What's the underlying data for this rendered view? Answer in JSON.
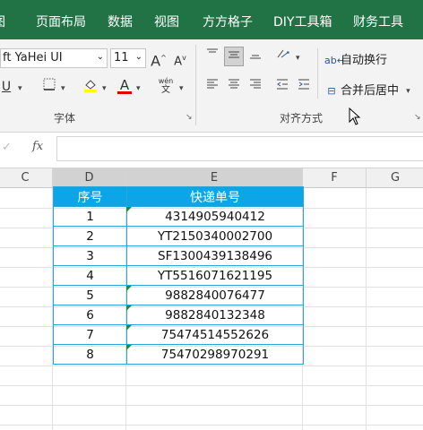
{
  "tabs": [
    "图",
    "页面布局",
    "数据",
    "视图",
    "方方格子",
    "DIY工具箱",
    "财务工具"
  ],
  "ribbon": {
    "font_name": "ft YaHei UI",
    "font_size": "11",
    "grow_font": "A",
    "shrink_font": "A",
    "underline": "U",
    "font_color_letter": "A",
    "phonetic_top": "wén",
    "phonetic_bottom": "文",
    "wrap_text": "自动换行",
    "merge_center": "合并后居中",
    "group_font": "字体",
    "group_alignment": "对齐方式",
    "fill_color": "#ffff00",
    "font_color": "#e00000"
  },
  "formula_bar": {
    "fx": "fx",
    "cancel": "✓",
    "value": ""
  },
  "columns": [
    "C",
    "D",
    "E",
    "F",
    "G"
  ],
  "table": {
    "headers": [
      "序号",
      "快递单号"
    ],
    "rows": [
      {
        "no": "1",
        "tracking": "4314905940412",
        "flag": true
      },
      {
        "no": "2",
        "tracking": "YT2150340002700",
        "flag": false
      },
      {
        "no": "3",
        "tracking": "SF1300439138496",
        "flag": false
      },
      {
        "no": "4",
        "tracking": "YT5516071621195",
        "flag": false
      },
      {
        "no": "5",
        "tracking": "9882840076477",
        "flag": true
      },
      {
        "no": "6",
        "tracking": "9882840132348",
        "flag": true
      },
      {
        "no": "7",
        "tracking": "75474514552626",
        "flag": true
      },
      {
        "no": "8",
        "tracking": "75470298970291",
        "flag": true
      }
    ]
  }
}
